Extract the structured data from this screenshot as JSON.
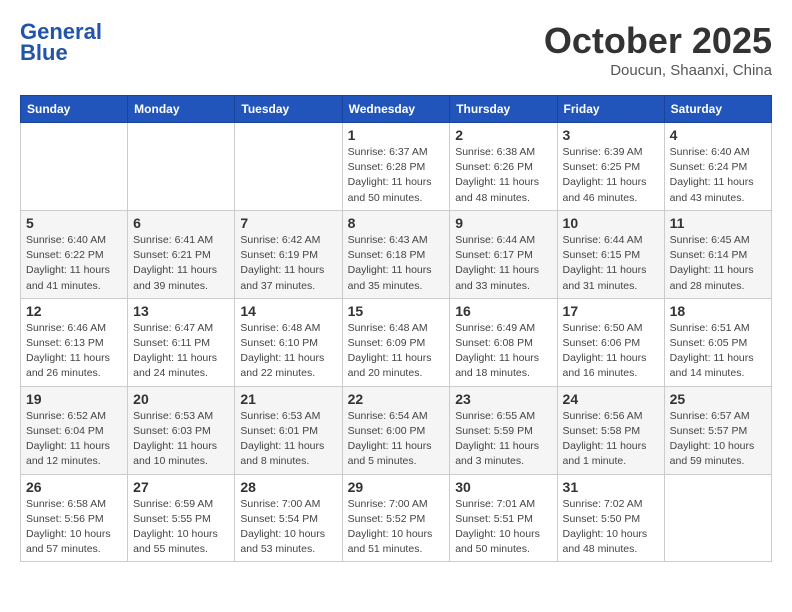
{
  "header": {
    "logo_line1": "General",
    "logo_line2": "Blue",
    "month": "October 2025",
    "location": "Doucun, Shaanxi, China"
  },
  "days_of_week": [
    "Sunday",
    "Monday",
    "Tuesday",
    "Wednesday",
    "Thursday",
    "Friday",
    "Saturday"
  ],
  "weeks": [
    [
      {
        "num": "",
        "info": ""
      },
      {
        "num": "",
        "info": ""
      },
      {
        "num": "",
        "info": ""
      },
      {
        "num": "1",
        "info": "Sunrise: 6:37 AM\nSunset: 6:28 PM\nDaylight: 11 hours\nand 50 minutes."
      },
      {
        "num": "2",
        "info": "Sunrise: 6:38 AM\nSunset: 6:26 PM\nDaylight: 11 hours\nand 48 minutes."
      },
      {
        "num": "3",
        "info": "Sunrise: 6:39 AM\nSunset: 6:25 PM\nDaylight: 11 hours\nand 46 minutes."
      },
      {
        "num": "4",
        "info": "Sunrise: 6:40 AM\nSunset: 6:24 PM\nDaylight: 11 hours\nand 43 minutes."
      }
    ],
    [
      {
        "num": "5",
        "info": "Sunrise: 6:40 AM\nSunset: 6:22 PM\nDaylight: 11 hours\nand 41 minutes."
      },
      {
        "num": "6",
        "info": "Sunrise: 6:41 AM\nSunset: 6:21 PM\nDaylight: 11 hours\nand 39 minutes."
      },
      {
        "num": "7",
        "info": "Sunrise: 6:42 AM\nSunset: 6:19 PM\nDaylight: 11 hours\nand 37 minutes."
      },
      {
        "num": "8",
        "info": "Sunrise: 6:43 AM\nSunset: 6:18 PM\nDaylight: 11 hours\nand 35 minutes."
      },
      {
        "num": "9",
        "info": "Sunrise: 6:44 AM\nSunset: 6:17 PM\nDaylight: 11 hours\nand 33 minutes."
      },
      {
        "num": "10",
        "info": "Sunrise: 6:44 AM\nSunset: 6:15 PM\nDaylight: 11 hours\nand 31 minutes."
      },
      {
        "num": "11",
        "info": "Sunrise: 6:45 AM\nSunset: 6:14 PM\nDaylight: 11 hours\nand 28 minutes."
      }
    ],
    [
      {
        "num": "12",
        "info": "Sunrise: 6:46 AM\nSunset: 6:13 PM\nDaylight: 11 hours\nand 26 minutes."
      },
      {
        "num": "13",
        "info": "Sunrise: 6:47 AM\nSunset: 6:11 PM\nDaylight: 11 hours\nand 24 minutes."
      },
      {
        "num": "14",
        "info": "Sunrise: 6:48 AM\nSunset: 6:10 PM\nDaylight: 11 hours\nand 22 minutes."
      },
      {
        "num": "15",
        "info": "Sunrise: 6:48 AM\nSunset: 6:09 PM\nDaylight: 11 hours\nand 20 minutes."
      },
      {
        "num": "16",
        "info": "Sunrise: 6:49 AM\nSunset: 6:08 PM\nDaylight: 11 hours\nand 18 minutes."
      },
      {
        "num": "17",
        "info": "Sunrise: 6:50 AM\nSunset: 6:06 PM\nDaylight: 11 hours\nand 16 minutes."
      },
      {
        "num": "18",
        "info": "Sunrise: 6:51 AM\nSunset: 6:05 PM\nDaylight: 11 hours\nand 14 minutes."
      }
    ],
    [
      {
        "num": "19",
        "info": "Sunrise: 6:52 AM\nSunset: 6:04 PM\nDaylight: 11 hours\nand 12 minutes."
      },
      {
        "num": "20",
        "info": "Sunrise: 6:53 AM\nSunset: 6:03 PM\nDaylight: 11 hours\nand 10 minutes."
      },
      {
        "num": "21",
        "info": "Sunrise: 6:53 AM\nSunset: 6:01 PM\nDaylight: 11 hours\nand 8 minutes."
      },
      {
        "num": "22",
        "info": "Sunrise: 6:54 AM\nSunset: 6:00 PM\nDaylight: 11 hours\nand 5 minutes."
      },
      {
        "num": "23",
        "info": "Sunrise: 6:55 AM\nSunset: 5:59 PM\nDaylight: 11 hours\nand 3 minutes."
      },
      {
        "num": "24",
        "info": "Sunrise: 6:56 AM\nSunset: 5:58 PM\nDaylight: 11 hours\nand 1 minute."
      },
      {
        "num": "25",
        "info": "Sunrise: 6:57 AM\nSunset: 5:57 PM\nDaylight: 10 hours\nand 59 minutes."
      }
    ],
    [
      {
        "num": "26",
        "info": "Sunrise: 6:58 AM\nSunset: 5:56 PM\nDaylight: 10 hours\nand 57 minutes."
      },
      {
        "num": "27",
        "info": "Sunrise: 6:59 AM\nSunset: 5:55 PM\nDaylight: 10 hours\nand 55 minutes."
      },
      {
        "num": "28",
        "info": "Sunrise: 7:00 AM\nSunset: 5:54 PM\nDaylight: 10 hours\nand 53 minutes."
      },
      {
        "num": "29",
        "info": "Sunrise: 7:00 AM\nSunset: 5:52 PM\nDaylight: 10 hours\nand 51 minutes."
      },
      {
        "num": "30",
        "info": "Sunrise: 7:01 AM\nSunset: 5:51 PM\nDaylight: 10 hours\nand 50 minutes."
      },
      {
        "num": "31",
        "info": "Sunrise: 7:02 AM\nSunset: 5:50 PM\nDaylight: 10 hours\nand 48 minutes."
      },
      {
        "num": "",
        "info": ""
      }
    ]
  ]
}
